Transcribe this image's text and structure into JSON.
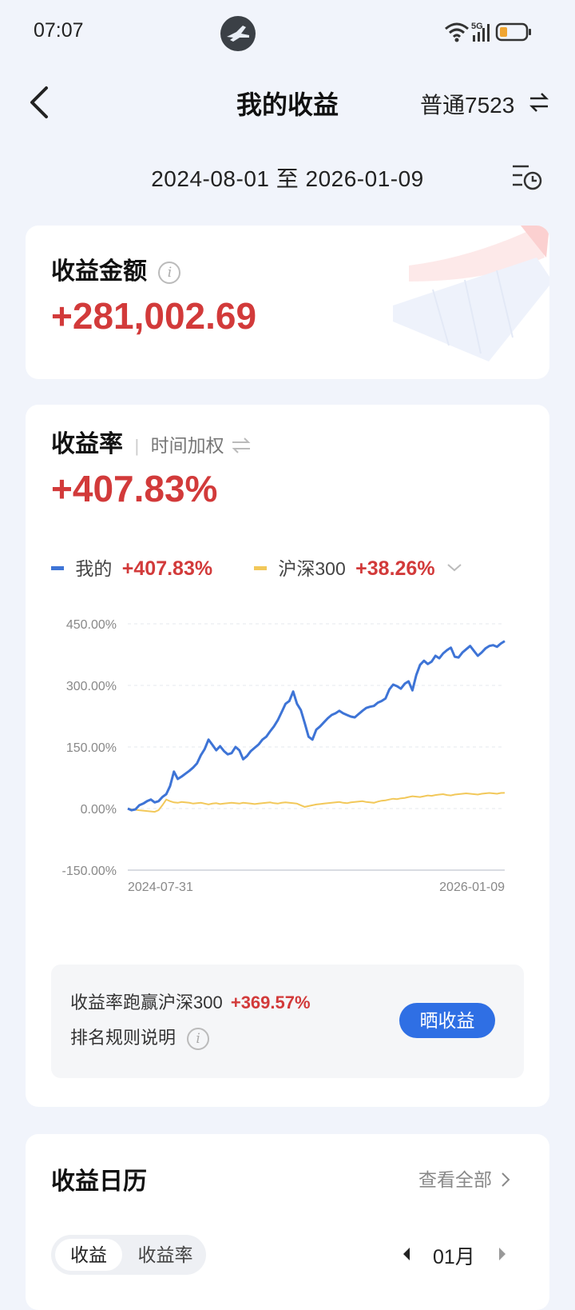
{
  "status_bar": {
    "time": "07:07",
    "network": "5G"
  },
  "header": {
    "title": "我的收益",
    "account": "普通7523"
  },
  "date_range": "2024-08-01 至 2026-01-09",
  "profit_card": {
    "label": "收益金额",
    "amount": "+281,002.69"
  },
  "return_card": {
    "label": "收益率",
    "weight_option": "时间加权",
    "rate": "+407.83%",
    "legend_mine_label": "我的",
    "legend_mine_value": "+407.83%",
    "legend_index_label": "沪深300",
    "legend_index_value": "+38.26%",
    "compare_text": "收益率跑赢沪深300",
    "compare_value": "+369.57%",
    "rule_text": "排名规则说明",
    "share_button": "晒收益"
  },
  "calendar_card": {
    "title": "收益日历",
    "view_all": "查看全部",
    "tab_profit": "收益",
    "tab_rate": "收益率",
    "month": "01月"
  },
  "colors": {
    "accent_red": "#d23a3a",
    "accent_blue": "#2f6fe4",
    "mine_line": "#3e74d6",
    "index_line": "#f2c85a"
  },
  "chart_data": {
    "type": "line",
    "x_start": "2024-07-31",
    "x_end": "2026-01-09",
    "x_labels": [
      "2024-07-31",
      "2026-01-09"
    ],
    "y_ticks": [
      "450.00%",
      "300.00%",
      "150.00%",
      "0.00%",
      "-150.00%"
    ],
    "ylim": [
      -150,
      450
    ],
    "grid": true,
    "series": [
      {
        "name": "我的",
        "color": "#3e74d6",
        "values": [
          0,
          -4,
          -2,
          8,
          12,
          18,
          22,
          15,
          18,
          28,
          35,
          55,
          90,
          72,
          78,
          85,
          92,
          100,
          110,
          130,
          145,
          168,
          155,
          142,
          152,
          140,
          132,
          135,
          150,
          142,
          120,
          128,
          140,
          148,
          156,
          168,
          175,
          188,
          200,
          215,
          235,
          255,
          262,
          285,
          255,
          240,
          208,
          175,
          168,
          192,
          200,
          210,
          220,
          228,
          232,
          238,
          232,
          228,
          224,
          222,
          230,
          238,
          245,
          248,
          250,
          258,
          262,
          268,
          290,
          302,
          298,
          292,
          304,
          310,
          288,
          325,
          350,
          360,
          352,
          358,
          372,
          366,
          378,
          386,
          392,
          370,
          368,
          380,
          388,
          396,
          384,
          372,
          380,
          390,
          396,
          398,
          394,
          402,
          407.83
        ]
      },
      {
        "name": "沪深300",
        "color": "#f2c85a",
        "values": [
          0,
          -2,
          -3,
          -4,
          -5,
          -6,
          -7,
          -8,
          -4,
          8,
          22,
          18,
          15,
          14,
          16,
          15,
          14,
          12,
          13,
          14,
          12,
          10,
          12,
          13,
          11,
          12,
          13,
          14,
          13,
          12,
          14,
          13,
          12,
          11,
          12,
          13,
          14,
          15,
          13,
          12,
          14,
          15,
          14,
          13,
          12,
          8,
          4,
          6,
          8,
          10,
          11,
          12,
          13,
          14,
          15,
          16,
          14,
          13,
          15,
          16,
          17,
          18,
          16,
          15,
          14,
          17,
          19,
          20,
          22,
          24,
          23,
          25,
          26,
          28,
          30,
          29,
          28,
          30,
          32,
          31,
          33,
          34,
          35,
          33,
          32,
          34,
          35,
          36,
          37,
          36,
          35,
          34,
          36,
          37,
          38,
          37,
          36,
          38,
          38.26
        ]
      }
    ]
  }
}
